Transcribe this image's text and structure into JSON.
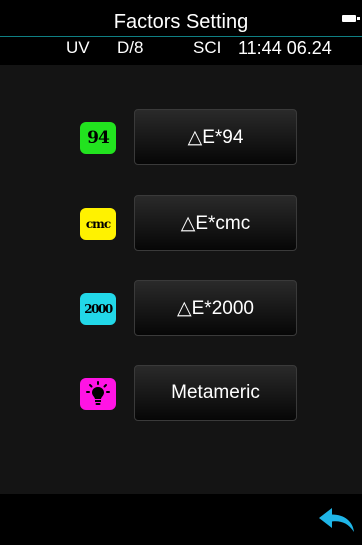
{
  "header": {
    "title": "Factors Setting",
    "battery_icon": "battery-icon",
    "divider_color": "#0f7f83"
  },
  "status": {
    "light_source": "UV",
    "geometry": "D/8",
    "mode": "SCI",
    "datetime": "11:44 06.24"
  },
  "menu": [
    {
      "badge_text": "94",
      "badge_color": "#22e31f",
      "label": "△E*94"
    },
    {
      "badge_text": "cmc",
      "badge_color": "#fff200",
      "label": "△E*cmc"
    },
    {
      "badge_text": "2000",
      "badge_color": "#22d8e8",
      "label": "△E*2000"
    },
    {
      "badge_icon": "lightbulb-icon",
      "badge_color": "#ff14e4",
      "label": "Metameric"
    }
  ],
  "footer": {
    "back_icon": "back-arrow-icon",
    "back_color": "#1fb6e8"
  }
}
